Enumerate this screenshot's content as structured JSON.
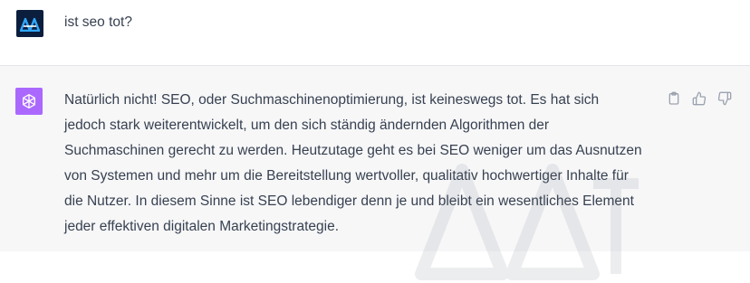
{
  "user_message": {
    "text": "ist seo tot?",
    "avatar_icon": "user-logo-icon"
  },
  "assistant_message": {
    "avatar_icon": "openai-logo-icon",
    "lines": [
      "Natürlich nicht! SEO, oder Suchmaschinenoptimierung, ist keineswegs tot. Es hat sich",
      "jedoch stark weiterentwickelt, um den sich ständig ändernden Algorithmen der",
      "Suchmaschinen gerecht zu werden. Heutzutage geht es bei SEO weniger um das Ausnutzen",
      "von Systemen und mehr um die Bereitstellung wertvoller, qualitativ hochwertiger Inhalte für",
      "die Nutzer. In diesem Sinne ist SEO lebendiger denn je und bleibt ein wesentliches Element",
      "jeder effektiven digitalen Marketingstrategie."
    ],
    "actions": [
      "clipboard-icon",
      "thumbs-up-icon",
      "thumbs-down-icon"
    ]
  },
  "colors": {
    "assistant_bg": "#f7f7f8",
    "assistant_avatar": "#ab68ff",
    "user_avatar": "#0b1e3d",
    "user_avatar_accent": "#2fa8ff",
    "text": "#374151",
    "icon": "#9ca3af"
  }
}
